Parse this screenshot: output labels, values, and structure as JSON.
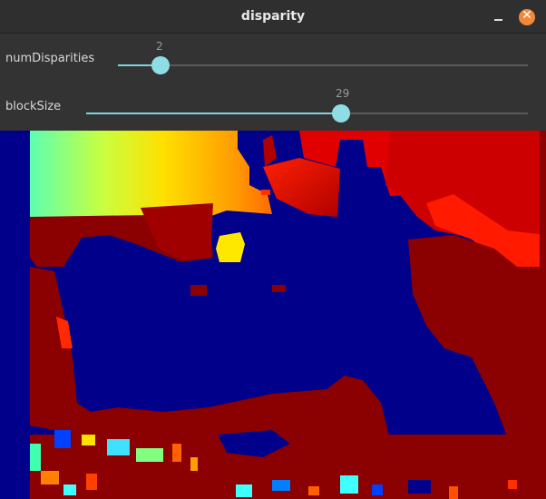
{
  "window": {
    "title": "disparity"
  },
  "controls": {
    "minimize_icon": "minimize-icon",
    "close_icon": "close-icon",
    "close_color": "#f08a3a"
  },
  "trackbars": [
    {
      "label": "numDisparities",
      "value": "2",
      "fraction": 0.105
    },
    {
      "label": "blockSize",
      "value": "29",
      "fraction": 0.578
    }
  ],
  "colors": {
    "accent": "#7ed3de",
    "background": "#333333",
    "disparity_far": "#00008b",
    "disparity_near": "#8b0000"
  }
}
